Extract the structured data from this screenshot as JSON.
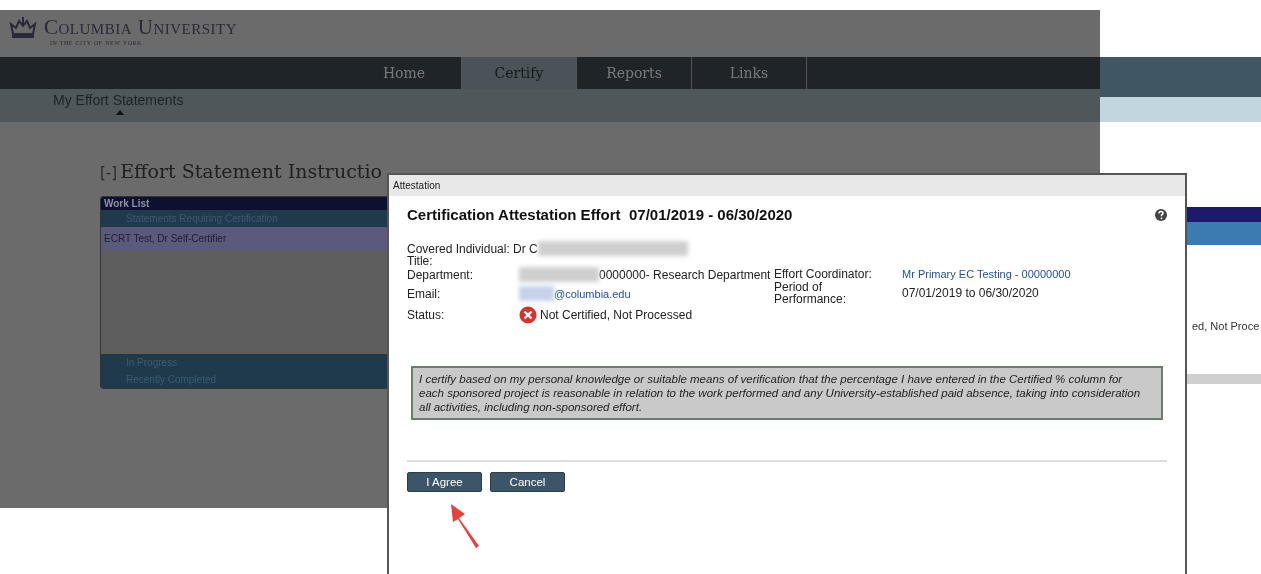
{
  "logo": {
    "name": "Columbia University",
    "tagline": "in the city of new york"
  },
  "nav": {
    "tabs": [
      {
        "label": "Home",
        "selected": false
      },
      {
        "label": "Certify",
        "selected": true
      },
      {
        "label": "Reports",
        "selected": false
      },
      {
        "label": "Links",
        "selected": false
      }
    ]
  },
  "subnav": {
    "label": "My Effort Statements"
  },
  "instructions": {
    "toggle": "[-]",
    "heading": "Effort Statement Instructio"
  },
  "work_list": {
    "title": "Work List",
    "sections": [
      {
        "label": "Statements Requiring Certification",
        "rows": [
          "ECRT Test, Dr Self-Certifier"
        ]
      },
      {
        "label": "In Progress"
      },
      {
        "label": "Recently Completed"
      }
    ]
  },
  "background_status": "ed, Not Proce",
  "dialog": {
    "title": "Attestation",
    "heading": "Certification Attestation Effort  07/01/2019 - 06/30/2020",
    "covered_individual": {
      "label": "Covered Individual:",
      "value": "Dr C"
    },
    "title_field": {
      "label": "Title:"
    },
    "department": {
      "label": "Department:",
      "value": "0000000- Research Department"
    },
    "email": {
      "label": "Email:",
      "value": "@columbia.edu"
    },
    "status": {
      "label": "Status:",
      "value": "Not Certified, Not Processed",
      "certified": false
    },
    "effort_coordinator": {
      "label": "Effort Coordinator:",
      "value": "Mr Primary EC Testing - 00000000"
    },
    "period": {
      "label": "Period of Performance:",
      "value": "07/01/2019 to 06/30/2020"
    },
    "statement": "I certify based on my personal knowledge or suitable means of verification that the percentage I have entered in the Certified % column for each sponsored project is reasonable in relation to the work performed and any University-established paid absence, taking into consideration all activities, including non-sponsored effort.",
    "buttons": [
      "I Agree",
      "Cancel"
    ]
  }
}
